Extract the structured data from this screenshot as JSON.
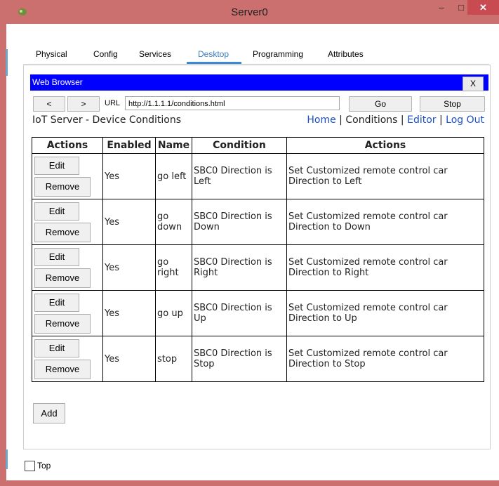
{
  "window": {
    "title": "Server0",
    "min": "–",
    "max": "□",
    "close": "✕"
  },
  "tabs": [
    {
      "label": "Physical"
    },
    {
      "label": "Config"
    },
    {
      "label": "Services"
    },
    {
      "label": "Desktop"
    },
    {
      "label": "Programming"
    },
    {
      "label": "Attributes"
    }
  ],
  "browser": {
    "title": "Web Browser",
    "close": "X",
    "back": "<",
    "forward": ">",
    "url_label": "URL",
    "url": "http://1.1.1.1/conditions.html",
    "go": "Go",
    "stop": "Stop"
  },
  "page": {
    "title": "IoT Server - Device Conditions",
    "links": {
      "home": "Home",
      "conditions": "Conditions",
      "editor": "Editor",
      "logout": "Log Out",
      "sep": " | "
    }
  },
  "table": {
    "headers": [
      "Actions",
      "Enabled",
      "Name",
      "Condition",
      "Actions"
    ],
    "edit_label": "Edit",
    "remove_label": "Remove",
    "rows": [
      {
        "enabled": "Yes",
        "name": "go left",
        "condition": "SBC0 Direction is Left",
        "action": "Set Customized remote control car Direction to Left"
      },
      {
        "enabled": "Yes",
        "name": "go down",
        "condition": "SBC0 Direction is Down",
        "action": "Set Customized remote control car Direction to Down"
      },
      {
        "enabled": "Yes",
        "name": "go right",
        "condition": "SBC0 Direction is Right",
        "action": "Set Customized remote control car Direction to Right"
      },
      {
        "enabled": "Yes",
        "name": "go up",
        "condition": "SBC0 Direction is Up",
        "action": "Set Customized remote control car Direction to Up"
      },
      {
        "enabled": "Yes",
        "name": "stop",
        "condition": "SBC0 Direction is Stop",
        "action": "Set Customized remote control car Direction to Stop"
      }
    ]
  },
  "add_label": "Add",
  "top_label": "Top"
}
